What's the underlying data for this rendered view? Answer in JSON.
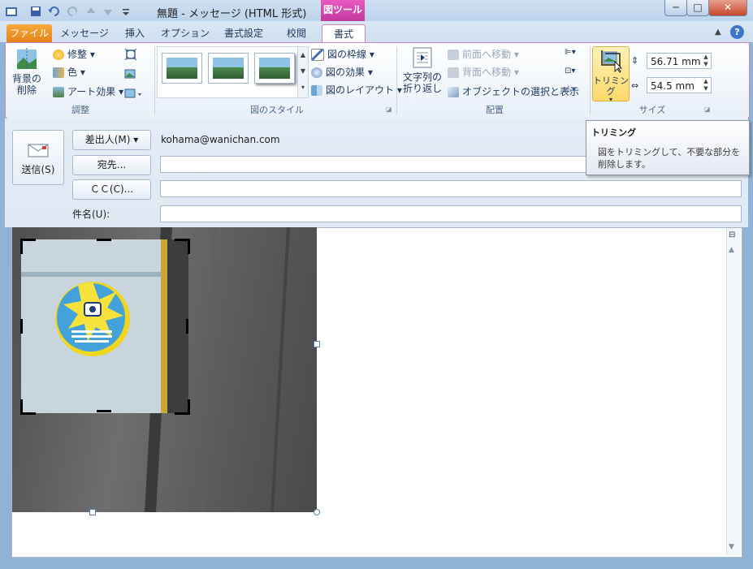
{
  "window": {
    "title": "無題 - メッセージ (HTML 形式)",
    "context_tool": "図ツール",
    "buttons": [
      "─",
      "□",
      "✕"
    ]
  },
  "tabs": [
    "ファイル",
    "メッセージ",
    "挿入",
    "オプション",
    "書式設定",
    "校閲",
    "書式"
  ],
  "ribbon": {
    "adjust": {
      "remove_bg_label": "背景の\n削除",
      "corrections": "修整",
      "color": "色",
      "artistic": "アート効果",
      "group_label": "調整"
    },
    "styles": {
      "border": "図の枠線",
      "effects": "図の効果",
      "layout": "図のレイアウト",
      "group_label": "図のスタイル"
    },
    "arrange": {
      "wrap_text": "文字列の\n折り返し",
      "bring_forward": "前面へ移動",
      "send_backward": "背面へ移動",
      "selection_pane": "オブジェクトの選択と表示",
      "group_label": "配置"
    },
    "size": {
      "crop": "トリミング",
      "height": "56.71 mm",
      "width": "54.5 mm",
      "group_label": "サイズ"
    }
  },
  "message": {
    "send": "送信(S)",
    "from_button": "差出人(M)",
    "from_value": "kohama@wanichan.com",
    "to_button": "宛先...",
    "cc_button": "ＣＣ(C)...",
    "subject_label": "件名(U):"
  },
  "tooltip": {
    "title": "トリミング",
    "body": "図をトリミングして、不要な部分を削除します。"
  },
  "colors": {
    "accent_context": "#c2399e",
    "file_tab": "#e4821a",
    "highlight": "#fbd96a"
  }
}
